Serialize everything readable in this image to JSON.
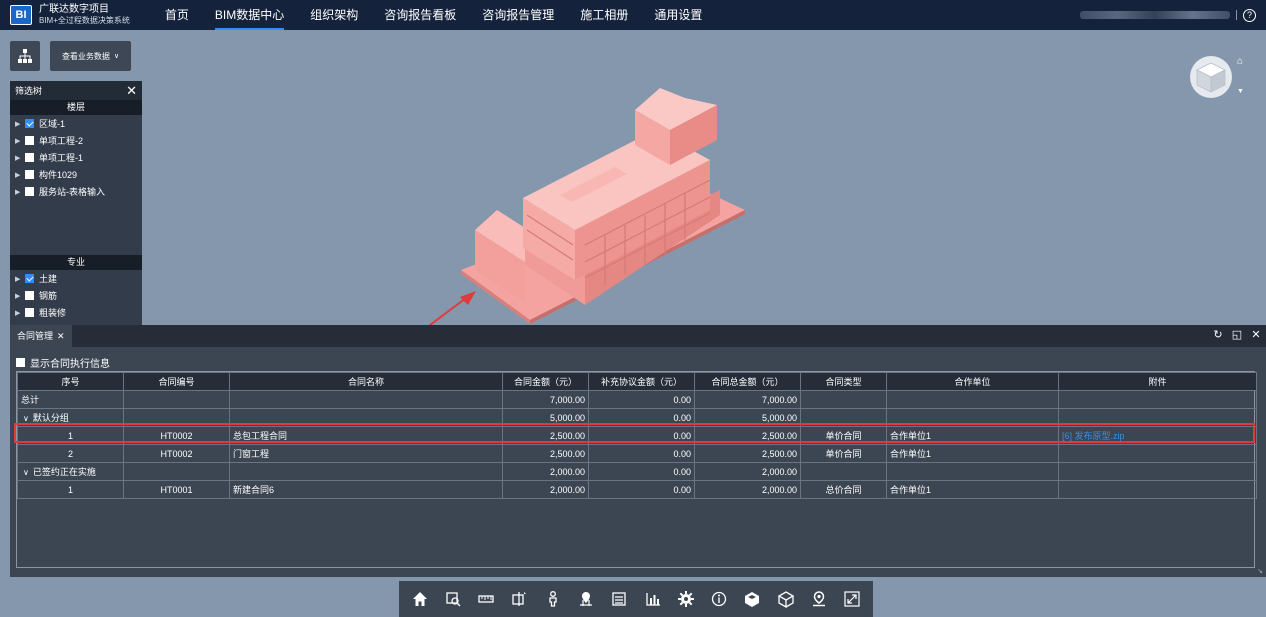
{
  "app": {
    "logo_text": "BI",
    "project_name": "广联达数字项目",
    "system_name": "BIM+全过程数据决策系统"
  },
  "nav": {
    "items": [
      "首页",
      "BIM数据中心",
      "组织架构",
      "咨询报告看板",
      "咨询报告管理",
      "施工相册",
      "通用设置"
    ],
    "active_index": 1
  },
  "header_right": {
    "separator": "|",
    "help": "?"
  },
  "controls": {
    "view_business_label": "查看业务数据"
  },
  "filter_tree": {
    "title": "筛选树",
    "close": "✕",
    "floors_title": "楼层",
    "floors": [
      {
        "label": "区域-1",
        "checked": true
      },
      {
        "label": "单项工程-2",
        "checked": false
      },
      {
        "label": "单项工程-1",
        "checked": false
      },
      {
        "label": "构件1029",
        "checked": false
      },
      {
        "label": "服务站-表格输入",
        "checked": false
      }
    ],
    "discipline_title": "专业",
    "disciplines": [
      {
        "label": "土建",
        "checked": true
      },
      {
        "label": "钢筋",
        "checked": false
      },
      {
        "label": "粗装修",
        "checked": false
      }
    ]
  },
  "contract_panel": {
    "tab_label": "合同管理",
    "tab_close": "✕",
    "show_exec_label": "显示合同执行信息",
    "columns": [
      "序号",
      "合同编号",
      "合同名称",
      "合同金额（元）",
      "补充协议金额（元）",
      "合同总金额（元）",
      "合同类型",
      "合作单位",
      "附件"
    ],
    "rows": [
      {
        "kind": "total",
        "seq": "总计",
        "code": "",
        "name": "",
        "amount": "7,000.00",
        "supplement": "0.00",
        "total": "7,000.00",
        "type": "",
        "partner": "",
        "attachment": ""
      },
      {
        "kind": "group",
        "seq": "默认分组",
        "code": "",
        "name": "",
        "amount": "5,000.00",
        "supplement": "0.00",
        "total": "5,000.00",
        "type": "",
        "partner": "",
        "attachment": ""
      },
      {
        "kind": "item",
        "seq": "1",
        "code": "HT0002",
        "name": "总包工程合同",
        "amount": "2,500.00",
        "supplement": "0.00",
        "total": "2,500.00",
        "type": "单价合同",
        "partner": "合作单位1",
        "attachment": "[6] 发布原型.zip"
      },
      {
        "kind": "item",
        "seq": "2",
        "code": "HT0002",
        "name": "门窗工程",
        "amount": "2,500.00",
        "supplement": "0.00",
        "total": "2,500.00",
        "type": "单价合同",
        "partner": "合作单位1",
        "attachment": ""
      },
      {
        "kind": "group",
        "seq": "已签约正在实施",
        "code": "",
        "name": "",
        "amount": "2,000.00",
        "supplement": "0.00",
        "total": "2,000.00",
        "type": "",
        "partner": "",
        "attachment": ""
      },
      {
        "kind": "item",
        "seq": "1",
        "code": "HT0001",
        "name": "新建合同6",
        "amount": "2,000.00",
        "supplement": "0.00",
        "total": "2,000.00",
        "type": "总价合同",
        "partner": "合作单位1",
        "attachment": ""
      }
    ]
  },
  "toolbar_icons": [
    "home-icon",
    "zoom-window-icon",
    "measure-icon",
    "section-icon",
    "person-icon",
    "location-icon",
    "list-icon",
    "chart-icon",
    "settings-icon",
    "info-icon",
    "model-icon",
    "cube-icon",
    "map-pin-icon",
    "fullscreen-icon"
  ],
  "colors": {
    "accent": "#2e8dff",
    "highlight": "#e03a3a",
    "model": "#f4a3a0",
    "background": "#8497ad"
  }
}
